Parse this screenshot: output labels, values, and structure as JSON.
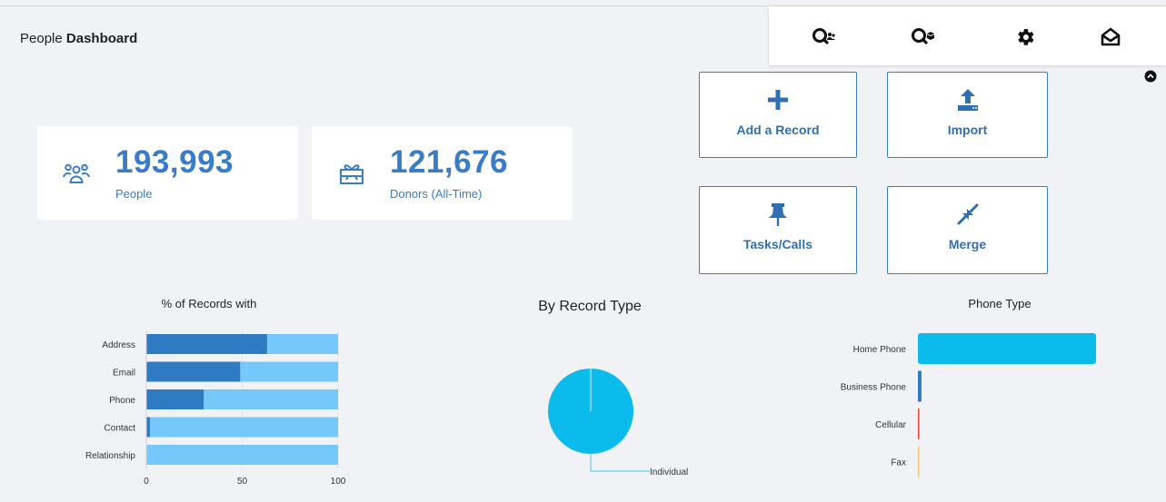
{
  "page": {
    "title_prefix": "People",
    "title_bold": "Dashboard"
  },
  "toolbar": {
    "items": [
      {
        "icon": "search-people-icon"
      },
      {
        "icon": "search-donor-icon"
      },
      {
        "icon": "gear-icon"
      },
      {
        "icon": "envelope-open-icon"
      }
    ],
    "collapse_icon": "chevron-up-circle-icon"
  },
  "stats": [
    {
      "value": "193,993",
      "label": "People",
      "icon": "people-icon"
    },
    {
      "value": "121,676",
      "label": "Donors (All-Time)",
      "icon": "gift-icon"
    }
  ],
  "quick_actions": [
    {
      "label": "Add a Record",
      "icon": "plus-icon"
    },
    {
      "label": "Import",
      "icon": "upload-icon"
    },
    {
      "label": "Tasks/Calls",
      "icon": "pin-icon"
    },
    {
      "label": "Merge",
      "icon": "merge-arrows-icon"
    }
  ],
  "colors": {
    "accent": "#3a7cc6",
    "bar_dark": "#2f7bc2",
    "bar_light": "#75c8fa",
    "pie": "#0bbbec",
    "phone_home": "#0bbbec",
    "phone_business": "#2f7bc2",
    "phone_cellular": "#e8453c",
    "phone_fax": "#f3c873"
  },
  "chart_data": [
    {
      "type": "bar",
      "orientation": "horizontal",
      "stacked": true,
      "title": "% of Records with",
      "categories": [
        "Address",
        "Email",
        "Phone",
        "Contact",
        "Relationship"
      ],
      "series": [
        {
          "values": [
            63,
            49,
            30,
            2,
            0
          ]
        },
        {
          "values": [
            37,
            51,
            70,
            98,
            100
          ]
        }
      ],
      "xlim": [
        0,
        100
      ],
      "xticks": [
        "0",
        "50",
        "100"
      ],
      "grid": true
    },
    {
      "type": "pie",
      "title": "By Record Type",
      "slices": [
        {
          "label": "Individual",
          "value": 100
        }
      ]
    },
    {
      "type": "bar",
      "orientation": "horizontal",
      "title": "Phone Type",
      "categories": [
        "Home Phone",
        "Business Phone",
        "Cellular",
        "Fax"
      ],
      "values": [
        100,
        2,
        0.8,
        0.6
      ]
    }
  ]
}
